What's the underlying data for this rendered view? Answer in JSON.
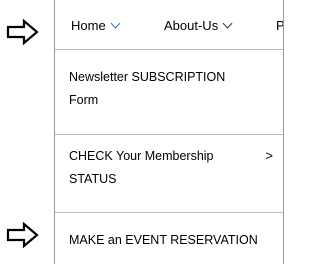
{
  "nav": {
    "home_label": "Home",
    "about_label": "About-Us",
    "next_label_clipped": "P"
  },
  "menu": {
    "items": [
      {
        "line1": "Newsletter SUBSCRIPTION",
        "line2": "Form"
      },
      {
        "line1": "CHECK Your Membership",
        "line2": "STATUS",
        "submenu_indicator": ">"
      },
      {
        "line1": "MAKE an EVENT RESERVATION"
      }
    ]
  },
  "colors": {
    "home_chevron": "#3d6fbf",
    "divider": "#bdbdbd"
  },
  "icons": {
    "pointer_arrows": "right-arrow-outline"
  }
}
